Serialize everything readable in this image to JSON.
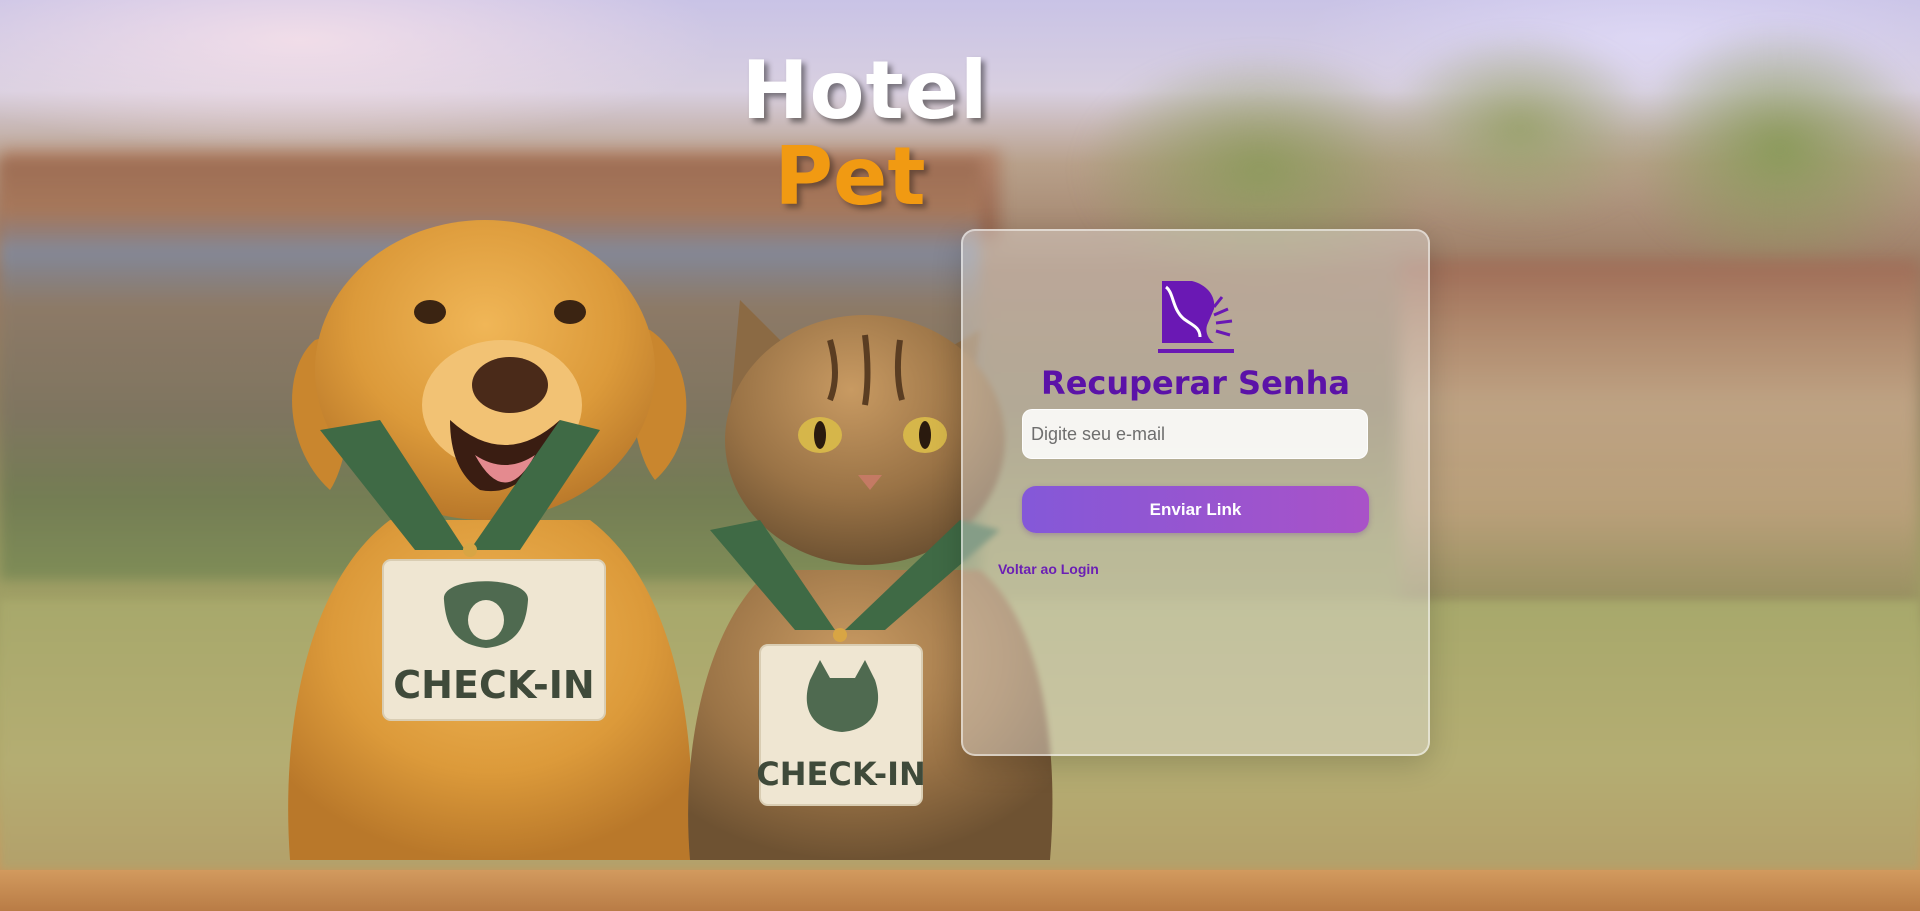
{
  "brand": {
    "line1": "Hotel",
    "line2": "Pet"
  },
  "card": {
    "logo_icon": "horse-head-icon",
    "title": "Recuperar Senha",
    "email_placeholder": "Digite seu e-mail",
    "email_value": "",
    "submit_label": "Enviar Link",
    "back_link_label": "Voltar ao Login"
  },
  "badges": {
    "dog_badge_text": "CHECK-IN",
    "cat_badge_text": "CHECK-IN"
  },
  "colors": {
    "title": "#5b12a8",
    "brand_pet": "#f19a12",
    "button_start": "#8458d8",
    "button_end": "#a952c8",
    "link": "#6b1fb5"
  }
}
